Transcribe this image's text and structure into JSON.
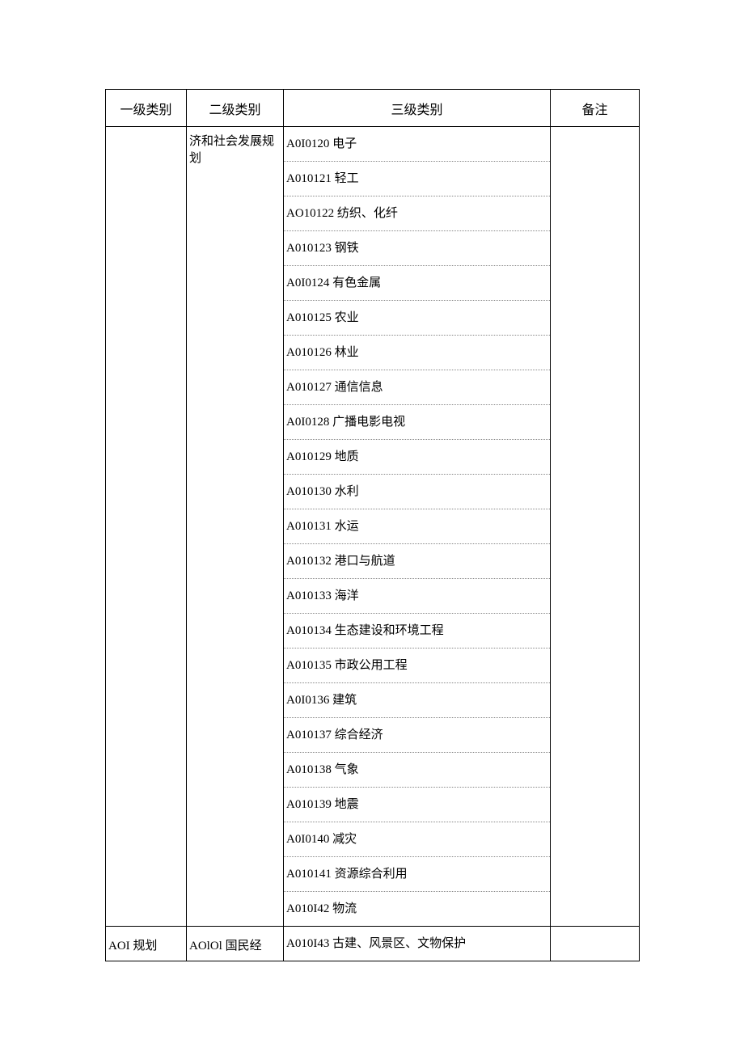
{
  "headers": {
    "col1": "一级类别",
    "col2": "二级类别",
    "col3": "三级类别",
    "col4": "备注"
  },
  "row1": {
    "level1": "",
    "level2": "济和社会发展规划",
    "remark": "",
    "items": [
      "A0I0120 电子",
      "A010121 轻工",
      "AO10122 纺织、化纤",
      "A010123 钢铁",
      "A0I0124 有色金属",
      "A010125 农业",
      "A010126 林业",
      "A010127 通信信息",
      "A0I0128 广播电影电视",
      "A010129 地质",
      "A010130 水利",
      "A010131 水运",
      "A010132 港口与航道",
      "A010133 海洋",
      "A010134 生态建设和环境工程",
      "A010135 市政公用工程",
      "A0I0136 建筑",
      "A010137 综合经济",
      "A010138 气象",
      "A010139 地震",
      "A0I0140 减灾",
      "A010141 资源综合利用",
      "A010I42 物流"
    ]
  },
  "row2": {
    "level1": "AOI 规划",
    "level2": "AOlOl 国民经",
    "level3": "A010I43 古建、风景区、文物保护",
    "remark": ""
  }
}
